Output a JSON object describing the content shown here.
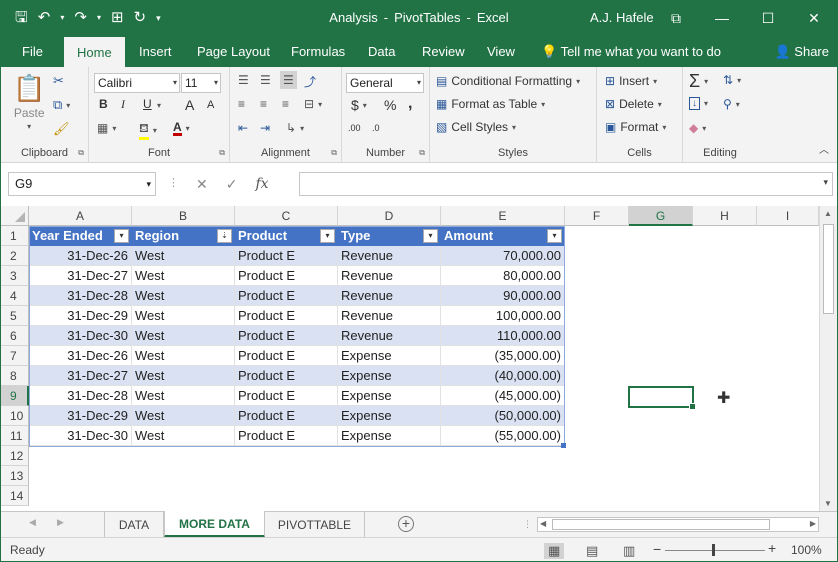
{
  "window": {
    "document_name": "Analysis",
    "separator": "-",
    "app_part": "PivotTables",
    "app_name": "Excel",
    "user": "A.J. Hafele"
  },
  "qat": {
    "save_icon": "save-icon",
    "undo_icon": "undo-icon",
    "redo_icon": "redo-icon"
  },
  "tabs": [
    {
      "label": "File"
    },
    {
      "label": "Home"
    },
    {
      "label": "Insert"
    },
    {
      "label": "Page Layout"
    },
    {
      "label": "Formulas"
    },
    {
      "label": "Data"
    },
    {
      "label": "Review"
    },
    {
      "label": "View"
    }
  ],
  "tell_me": "Tell me what you want to do",
  "share": "Share",
  "ribbon": {
    "clipboard": {
      "label": "Clipboard",
      "paste": "Paste"
    },
    "font": {
      "label": "Font",
      "name": "Calibri",
      "size": "11",
      "bold": "B",
      "italic": "I",
      "underline": "U",
      "grow": "A",
      "shrink": "A"
    },
    "alignment": {
      "label": "Alignment"
    },
    "number": {
      "label": "Number",
      "format": "General",
      "currency": "$",
      "percent": "%",
      "comma": ",",
      "inc_dec": ".00",
      "dec_dec": ".0"
    },
    "styles": {
      "label": "Styles",
      "conditional": "Conditional Formatting",
      "format_table": "Format as Table",
      "cell_styles": "Cell Styles"
    },
    "cells": {
      "label": "Cells",
      "insert": "Insert",
      "delete": "Delete",
      "format": "Format"
    },
    "editing": {
      "label": "Editing"
    }
  },
  "formula_bar": {
    "name_box": "G9",
    "cancel": "✕",
    "enter": "✓",
    "fx": "fx",
    "value": ""
  },
  "columns": [
    "A",
    "B",
    "C",
    "D",
    "E",
    "F",
    "G",
    "H",
    "I"
  ],
  "rows": [
    "1",
    "2",
    "3",
    "4",
    "5",
    "6",
    "7",
    "8",
    "9",
    "10",
    "11",
    "12",
    "13",
    "14"
  ],
  "table": {
    "headers": [
      "Year Ended",
      "Region",
      "Product",
      "Type",
      "Amount"
    ],
    "data": [
      [
        "31-Dec-26",
        "West",
        "Product E",
        "Revenue",
        "70,000.00"
      ],
      [
        "31-Dec-27",
        "West",
        "Product E",
        "Revenue",
        "80,000.00"
      ],
      [
        "31-Dec-28",
        "West",
        "Product E",
        "Revenue",
        "90,000.00"
      ],
      [
        "31-Dec-29",
        "West",
        "Product E",
        "Revenue",
        "100,000.00"
      ],
      [
        "31-Dec-30",
        "West",
        "Product E",
        "Revenue",
        "110,000.00"
      ],
      [
        "31-Dec-26",
        "West",
        "Product E",
        "Expense",
        "(35,000.00)"
      ],
      [
        "31-Dec-27",
        "West",
        "Product E",
        "Expense",
        "(40,000.00)"
      ],
      [
        "31-Dec-28",
        "West",
        "Product E",
        "Expense",
        "(45,000.00)"
      ],
      [
        "31-Dec-29",
        "West",
        "Product E",
        "Expense",
        "(50,000.00)"
      ],
      [
        "31-Dec-30",
        "West",
        "Product E",
        "Expense",
        "(55,000.00)"
      ]
    ]
  },
  "sheets": [
    {
      "label": "DATA"
    },
    {
      "label": "MORE DATA"
    },
    {
      "label": "PIVOTTABLE"
    }
  ],
  "status": {
    "text": "Ready",
    "zoom": "100%",
    "minus": "−",
    "plus": "+"
  },
  "colors": {
    "excel_green": "#217346",
    "table_header": "#4472c4",
    "table_band": "#d9e1f2"
  }
}
